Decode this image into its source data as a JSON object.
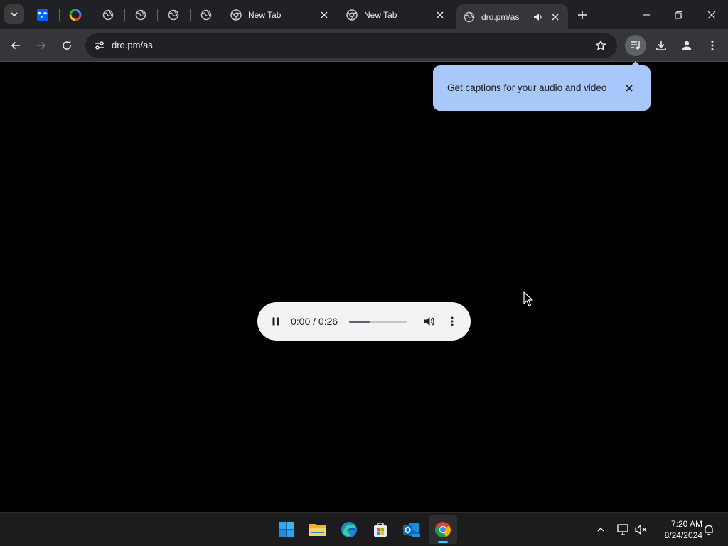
{
  "browser": {
    "tabs": [
      {
        "title": "New Tab",
        "icon": "chrome-icon"
      },
      {
        "title": "New Tab",
        "icon": "chrome-icon"
      },
      {
        "title": "dro.pm/as",
        "icon": "globe-icon",
        "active": true,
        "audio": true
      }
    ],
    "pinned_icons": [
      "dropbox-icon",
      "google-photos-icon",
      "globe-icon",
      "globe-icon",
      "globe-icon",
      "globe-icon"
    ],
    "address": "dro.pm/as"
  },
  "caption_bubble": {
    "text": "Get captions for your audio and video"
  },
  "player": {
    "time": "0:00 / 0:26",
    "progress_fraction": 0.37,
    "state": "playing"
  },
  "taskbar": {
    "apps": [
      "windows-start-icon",
      "file-explorer-icon",
      "edge-icon",
      "store-icon",
      "outlook-icon",
      "chrome-icon"
    ],
    "time": "7:20 AM",
    "date": "8/24/2024"
  },
  "colors": {
    "bubble_bg": "#a8c7fa",
    "toolbar_bg": "#35363a",
    "tabstrip_bg": "#202124",
    "accent": "#4cc2ff"
  }
}
